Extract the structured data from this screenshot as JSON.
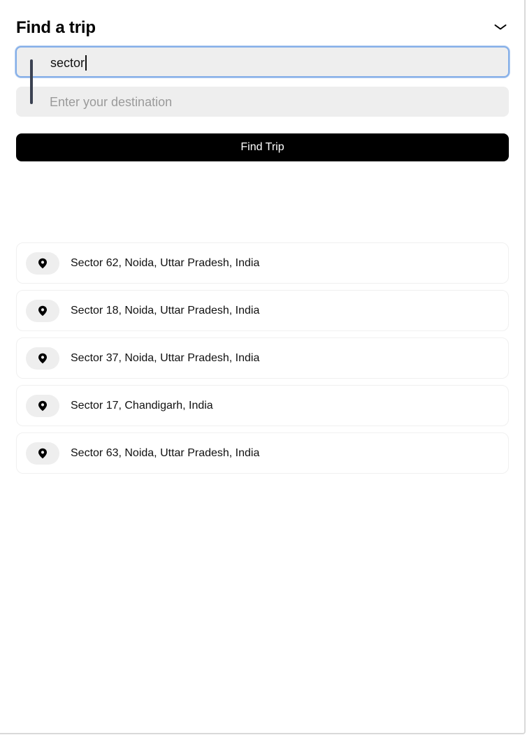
{
  "panel": {
    "title": "Find a trip",
    "collapse_icon": "chevron-down-icon"
  },
  "form": {
    "pickup_value": "sector",
    "destination_placeholder": "Enter your destination",
    "submit_label": "Find Trip"
  },
  "suggestions": [
    {
      "label": "Sector 62, Noida, Uttar Pradesh, India",
      "icon": "location-pin-icon"
    },
    {
      "label": "Sector 18, Noida, Uttar Pradesh, India",
      "icon": "location-pin-icon"
    },
    {
      "label": "Sector 37, Noida, Uttar Pradesh, India",
      "icon": "location-pin-icon"
    },
    {
      "label": "Sector 17, Chandigarh, India",
      "icon": "location-pin-icon"
    },
    {
      "label": "Sector 63, Noida, Uttar Pradesh, India",
      "icon": "location-pin-icon"
    }
  ],
  "colors": {
    "focus_border": "#84aee8",
    "button_bg": "#000000",
    "field_bg": "#eeeeee"
  }
}
